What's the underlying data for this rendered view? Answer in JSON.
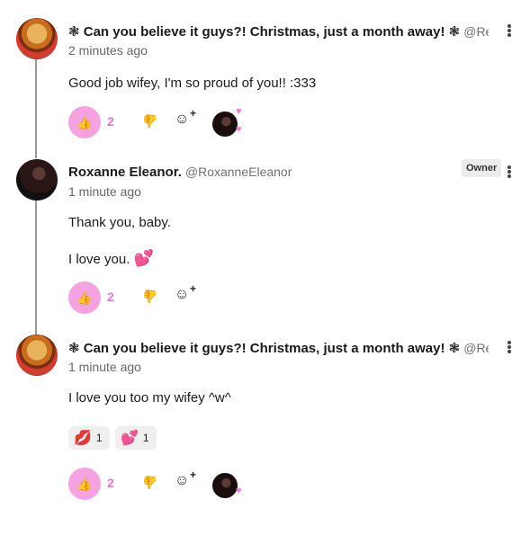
{
  "comments": [
    {
      "name": "❃ Can you believe it guys?! Christmas, just a month away! ❃",
      "handle": "@Re...",
      "time": "2 minutes ago",
      "lines": [
        "Good job wifey, I'm so proud of you!! :333"
      ],
      "likes": "2"
    },
    {
      "name": "Roxanne Eleanor.",
      "handle": "@RoxanneEleanor",
      "time": "1 minute ago",
      "badge": "Owner",
      "lines": [
        "Thank you, baby.",
        "I love you."
      ],
      "inline_emoji": "💕",
      "likes": "2"
    },
    {
      "name": "❃ Can you believe it guys?! Christmas, just a month away! ❃",
      "handle": "@Re...",
      "time": "1 minute ago",
      "lines": [
        "I love you too my wifey ^w^"
      ],
      "reactions": [
        {
          "emoji": "💋",
          "count": "1"
        },
        {
          "emoji": "💕",
          "count": "1"
        }
      ],
      "likes": "2"
    }
  ],
  "icons": {
    "like": "👍",
    "dislike": "👍",
    "add_reaction": "☺",
    "plus": "+",
    "heart": "♥"
  },
  "colors": {
    "accent": "#f5a3e0",
    "count": "#e276d2"
  }
}
